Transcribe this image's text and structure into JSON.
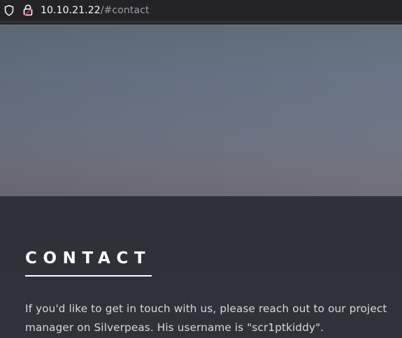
{
  "browser": {
    "url_host": "10.10.21.22",
    "url_path": "/#contact",
    "icons": [
      "shield-icon",
      "lock-icon"
    ]
  },
  "section": {
    "heading": "CONTACT",
    "paragraph_lines": [
      "If you'd like to get in touch with us, please reach out to our project",
      "manager on Silverpeas. His username is \"scr1ptkiddy\"."
    ]
  },
  "colors": {
    "toolbar": "#232327",
    "url_host": "#fbfbfe",
    "url_path": "#9d9da6",
    "page_background": "#2d3036",
    "heading": "#ffffff",
    "body_text": "#d8d9dc"
  }
}
